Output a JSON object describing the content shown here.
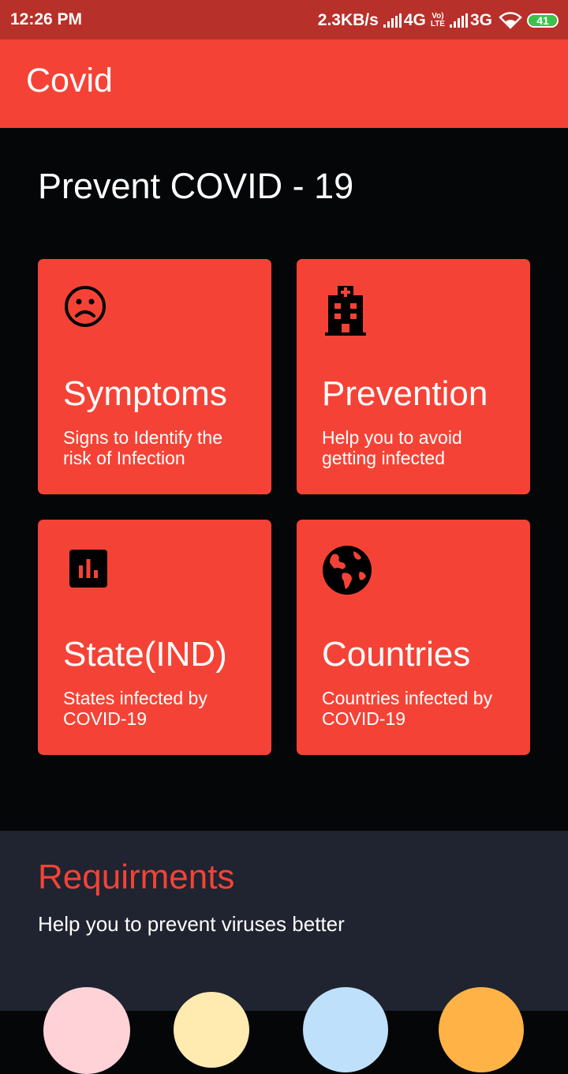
{
  "status": {
    "time": "12:26 PM",
    "speed": "2.3KB/s",
    "network1": "4G",
    "volte_top": "Vo)",
    "volte_bottom": "LTE",
    "network2": "3G",
    "battery": "41"
  },
  "app": {
    "title": "Covid"
  },
  "main": {
    "heading": "Prevent COVID - 19",
    "cards": [
      {
        "icon": "sad-face-icon",
        "title": "Symptoms",
        "subtitle": "Signs to Identify the risk of Infection"
      },
      {
        "icon": "hospital-icon",
        "title": "Prevention",
        "subtitle": "Help you to avoid getting infected"
      },
      {
        "icon": "bar-chart-icon",
        "title": "State(IND)",
        "subtitle": "States infected by COVID-19"
      },
      {
        "icon": "globe-icon",
        "title": "Countries",
        "subtitle": "Countries infected by COVID-19"
      }
    ]
  },
  "requirements": {
    "title": "Requirments",
    "subtitle": "Help you to prevent viruses better",
    "circle_colors": [
      "#ffd2d8",
      "#ffeab0",
      "#bfe0fb",
      "#ffb347"
    ]
  },
  "colors": {
    "accent": "#f44336",
    "status_bar": "#b8302a",
    "background": "#050608",
    "panel": "#1f2430"
  }
}
